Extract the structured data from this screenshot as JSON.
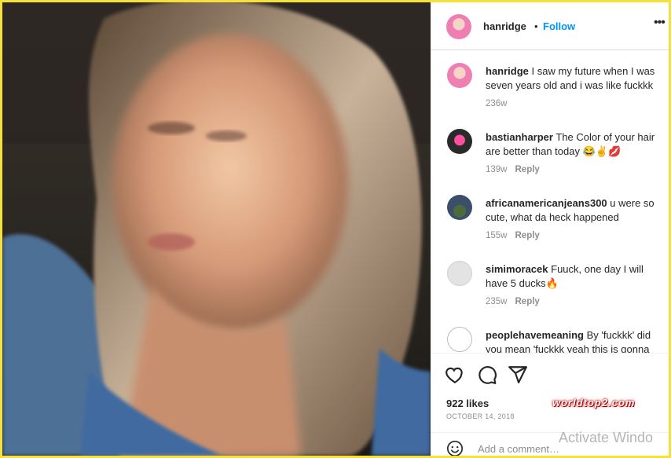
{
  "post": {
    "author": "hanridge",
    "follow_label": "Follow",
    "separator": "•",
    "more": "•••"
  },
  "comments": [
    {
      "user": "hanridge",
      "text": "I saw my future when I was seven years old and i was like fuckkk",
      "time": "236w",
      "reply": ""
    },
    {
      "user": "bastianharper",
      "text": "The Color of your hair are better than today 😂✌️💋",
      "time": "139w",
      "reply": "Reply"
    },
    {
      "user": "africanamericanjeans300",
      "text": "u were so cute, what da heck happened",
      "time": "155w",
      "reply": "Reply"
    },
    {
      "user": "simimoracek",
      "text": "Fuuck, one day I will have 5 ducks🔥",
      "time": "235w",
      "reply": "Reply"
    },
    {
      "user": "peoplehavemeaning",
      "text": "By 'fuckkk' did you mean 'fuckkk yeah this is gonna",
      "time": "",
      "reply": ""
    }
  ],
  "likes": "922 likes",
  "date": "OCTOBER 14, 2018",
  "add_comment_placeholder": "Add a comment…",
  "watermark": "worldtop2.com",
  "os_overlay": "Activate Windo",
  "icons": {
    "like": "heart-icon",
    "comment": "comment-icon",
    "share": "send-icon",
    "emoji": "smile-icon"
  },
  "colors": {
    "link_blue": "#0095f6",
    "frame_yellow": "#f5e13a",
    "watermark_red": "#c40000"
  }
}
